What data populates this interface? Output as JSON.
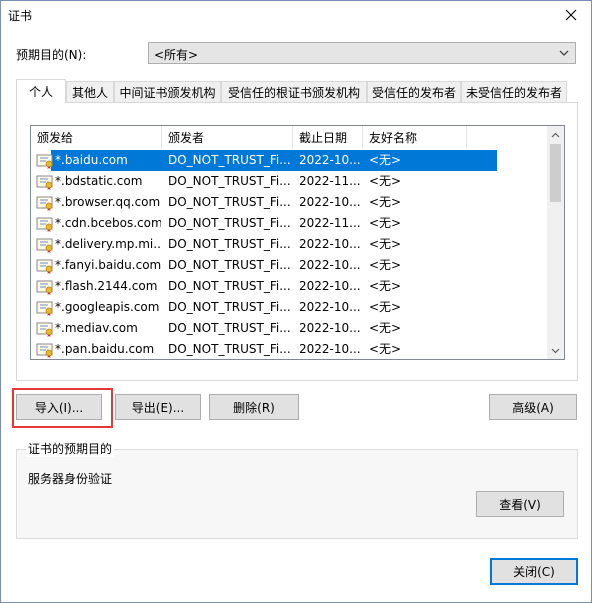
{
  "window": {
    "title": "证书"
  },
  "purpose": {
    "label": "预期目的(N):",
    "value": "<所有>"
  },
  "tabs": [
    {
      "label": "个人"
    },
    {
      "label": "其他人"
    },
    {
      "label": "中间证书颁发机构"
    },
    {
      "label": "受信任的根证书颁发机构"
    },
    {
      "label": "受信任的发布者"
    },
    {
      "label": "未受信任的发布者"
    }
  ],
  "columns": [
    "颁发给",
    "颁发者",
    "截止日期",
    "友好名称"
  ],
  "rows": [
    {
      "issued_to": "*.baidu.com",
      "issuer": "DO_NOT_TRUST_Fi...",
      "expires": "2022-10...",
      "friendly": "<无>"
    },
    {
      "issued_to": "*.bdstatic.com",
      "issuer": "DO_NOT_TRUST_Fi...",
      "expires": "2022-11...",
      "friendly": "<无>"
    },
    {
      "issued_to": "*.browser.qq.com",
      "issuer": "DO_NOT_TRUST_Fi...",
      "expires": "2022-10...",
      "friendly": "<无>"
    },
    {
      "issued_to": "*.cdn.bcebos.com",
      "issuer": "DO_NOT_TRUST_Fi...",
      "expires": "2022-11...",
      "friendly": "<无>"
    },
    {
      "issued_to": "*.delivery.mp.mi...",
      "issuer": "DO_NOT_TRUST_Fi...",
      "expires": "2022-10...",
      "friendly": "<无>"
    },
    {
      "issued_to": "*.fanyi.baidu.com",
      "issuer": "DO_NOT_TRUST_Fi...",
      "expires": "2022-10...",
      "friendly": "<无>"
    },
    {
      "issued_to": "*.flash.2144.com",
      "issuer": "DO_NOT_TRUST_Fi...",
      "expires": "2022-10...",
      "friendly": "<无>"
    },
    {
      "issued_to": "*.googleapis.com",
      "issuer": "DO_NOT_TRUST_Fi...",
      "expires": "2022-10...",
      "friendly": "<无>"
    },
    {
      "issued_to": "*.mediav.com",
      "issuer": "DO_NOT_TRUST_Fi...",
      "expires": "2022-10...",
      "friendly": "<无>"
    },
    {
      "issued_to": "*.pan.baidu.com",
      "issuer": "DO_NOT_TRUST_Fi...",
      "expires": "2022-10...",
      "friendly": "<无>"
    }
  ],
  "selected_row": 0,
  "buttons": {
    "import": "导入(I)...",
    "export": "导出(E)...",
    "remove": "删除(R)",
    "advanced": "高级(A)",
    "view": "查看(V)",
    "close": "关闭(C)"
  },
  "purposes_group": {
    "title": "证书的预期目的",
    "text": "服务器身份验证"
  },
  "colors": {
    "selection": "#0078d7",
    "highlight": "#e53935"
  },
  "icons": {
    "close": "close-icon",
    "dropdown": "chevron-down-icon",
    "certificate": "certificate-icon"
  }
}
